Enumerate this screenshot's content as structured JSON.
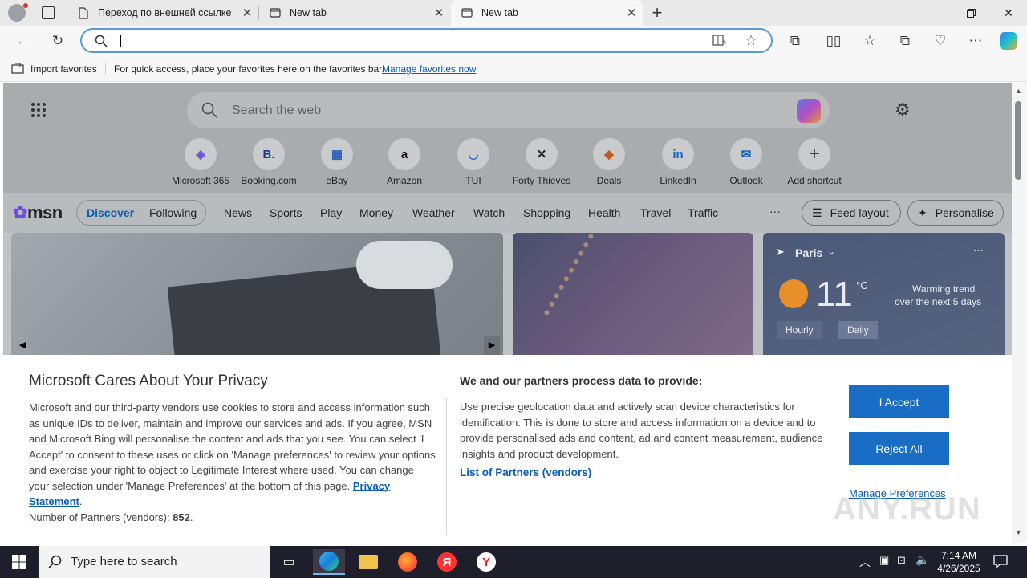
{
  "tabs": [
    {
      "label": "Переход по внешней ссылке",
      "active": false
    },
    {
      "label": "New tab",
      "active": false
    },
    {
      "label": "New tab",
      "active": true
    }
  ],
  "favorites_bar": {
    "import_label": "Import favorites",
    "hint": "For quick access, place your favorites here on the favorites bar.",
    "manage_link": "Manage favorites now"
  },
  "newtab": {
    "search_placeholder": "Search the web",
    "quick_links": [
      {
        "label": "Microsoft 365",
        "icon": "microsoft365-icon",
        "glyph": "◈"
      },
      {
        "label": "Booking.com",
        "icon": "booking-icon",
        "glyph": "B."
      },
      {
        "label": "eBay",
        "icon": "ebay-icon",
        "glyph": "▦"
      },
      {
        "label": "Amazon",
        "icon": "amazon-icon",
        "glyph": "a"
      },
      {
        "label": "TUI",
        "icon": "tui-icon",
        "glyph": "◡"
      },
      {
        "label": "Forty Thieves",
        "icon": "forty-thieves-icon",
        "glyph": "✕"
      },
      {
        "label": "Deals",
        "icon": "deals-icon",
        "glyph": "◆"
      },
      {
        "label": "LinkedIn",
        "icon": "linkedin-icon",
        "glyph": "in"
      },
      {
        "label": "Outlook",
        "icon": "outlook-icon",
        "glyph": "✉"
      },
      {
        "label": "Add shortcut",
        "icon": "plus-icon",
        "glyph": "+"
      }
    ],
    "msn": {
      "logo": "msn",
      "pill_tabs": [
        "Discover",
        "Following"
      ],
      "nav": [
        "News",
        "Sports",
        "Play",
        "Money",
        "Weather",
        "Watch",
        "Shopping",
        "Health",
        "Travel",
        "Traffic"
      ],
      "more": "···",
      "feed_layout": "Feed layout",
      "personalise": "Personalise"
    },
    "weather": {
      "city": "Paris",
      "temp": "11",
      "unit": "°C",
      "trend": "Warming trend",
      "trend_sub": "over the next 5 days",
      "tabs": [
        "Hourly",
        "Daily"
      ]
    }
  },
  "privacy": {
    "title": "Microsoft Cares About Your Privacy",
    "body": "Microsoft and our third-party vendors use cookies to store and access information such as unique IDs to deliver, maintain and improve our services and ads. If you agree, MSN and Microsoft Bing will personalise the content and ads that you see. You can select 'I Accept' to consent to these uses or click on 'Manage preferences' to review your options and exercise your right to object to Legitimate Interest where used.  You can change your selection under 'Manage Preferences' at the bottom of this page. ",
    "privacy_link": "Privacy Statement",
    "period": ".",
    "partners_label": "Number of Partners (vendors): ",
    "partners_count": "852",
    "partners_end": ".",
    "right_title": "We and our partners process data to provide:",
    "right_body": "Use precise geolocation data and actively scan device characteristics for identification. This is done to store and access information on a device and to provide personalised ads and content, ad and content measurement, audience insights and product development.",
    "list_link": "List of Partners (vendors)",
    "accept": "I Accept",
    "reject": "Reject All",
    "manage": "Manage Preferences"
  },
  "taskbar": {
    "search_placeholder": "Type here to search",
    "time": "7:14 AM",
    "date": "4/26/2025"
  },
  "watermark": "ANY.RUN"
}
